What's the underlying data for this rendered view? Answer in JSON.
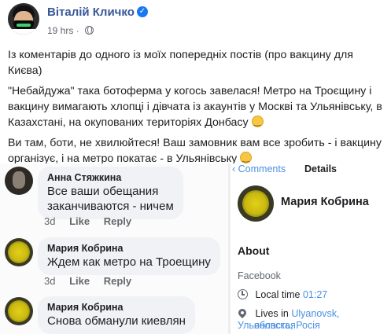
{
  "post": {
    "author": "Віталій Кличко",
    "time": "19 hrs",
    "separator": "·",
    "paragraphs": [
      "Із коментарів до одного із моїх попередніх постів (про вакцину для Києва)",
      "\"Небайдужа\" така ботоферма у когось завелася! Метро на Троєщину і вакцину вимагають хлопці і дівчата із акаунтів у Москві та Ульянівську, в Казахстані, на окупованих територіях Донбасу",
      "Ви там, боти, не хвилюйтеся! Ваш замовник вам все зробить - і вакцину організує, і на метро покатає - в Ульянівську"
    ]
  },
  "comments": [
    {
      "name": "Анна Стяжкина",
      "text_lines": [
        "Все ваши обещания",
        "заканчиваются - ничем"
      ],
      "age": "3d",
      "like": "Like",
      "reply": "Reply"
    },
    {
      "name": "Мария Кобрина",
      "text_lines": [
        "Ждем как метро на Троещину"
      ],
      "age": "3d",
      "like": "Like",
      "reply": "Reply"
    },
    {
      "name": "Мария Кобрина",
      "text_lines": [
        "Снова обманули киевлян"
      ]
    }
  ],
  "details": {
    "back_label": "Comments",
    "title": "Details",
    "name": "Мария Кобрина",
    "about_label": "About",
    "source": "Facebook",
    "local_time_label": "Local time",
    "local_time_value": "01:27",
    "lives_in_label": "Lives in",
    "lives_in_value_1": "Ulyanovsk,",
    "lives_in_value_2": "Ульяновская",
    "lives_in_value_3": "область, Росія"
  }
}
